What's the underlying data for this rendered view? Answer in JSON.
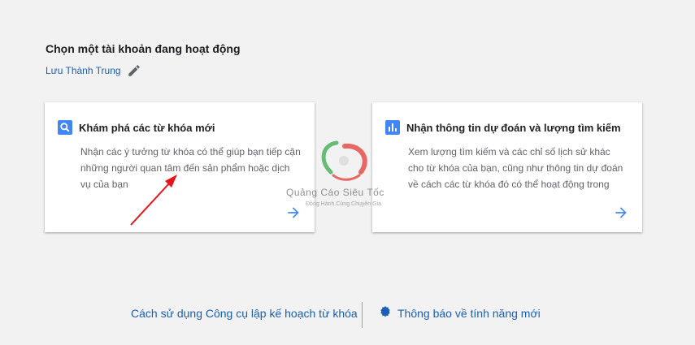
{
  "header": {
    "title": "Chọn một tài khoản đang hoạt động",
    "account_name": "Lưu Thành Trung"
  },
  "cards": [
    {
      "title": "Khám phá các từ khóa mới",
      "description": "Nhận các ý tưởng từ khóa có thể giúp bạn tiếp cận những người quan tâm đến sản phẩm hoặc dịch vụ của bạn",
      "icon": "search-icon"
    },
    {
      "title": "Nhận thông tin dự đoán và lượng tìm kiếm",
      "description": "Xem lượng tìm kiếm và các chỉ số lịch sử khác cho từ khóa của bạn, cũng như thông tin dự đoán về cách các từ khóa đó có thể hoạt động trong tương lai",
      "icon": "bar-chart-icon"
    }
  ],
  "footer": {
    "how_to_link": "Cách sử dụng Công cụ lập kế hoạch từ khóa",
    "new_features_link": "Thông báo về tính năng mới"
  },
  "watermark": {
    "name": "Quảng Cáo Siêu Tốc",
    "tagline": "Đồng Hành Cùng Chuyên Gia"
  },
  "colors": {
    "accent_blue": "#1a5fb4",
    "icon_blue": "#4285f4",
    "background": "#f2f2f2",
    "annotation_red": "#e8141c"
  }
}
